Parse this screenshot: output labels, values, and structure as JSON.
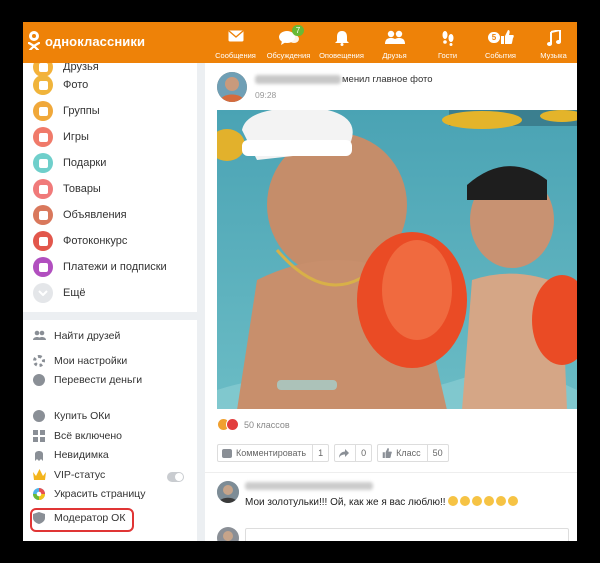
{
  "header": {
    "logo_text": "одноклассники",
    "nav": [
      {
        "label": "Сообщения",
        "icon": "envelope-icon",
        "badge": ""
      },
      {
        "label": "Обсуждения",
        "icon": "chat-bubbles-icon",
        "badge": "7"
      },
      {
        "label": "Оповещения",
        "icon": "bell-icon",
        "badge": ""
      },
      {
        "label": "Друзья",
        "icon": "people-icon",
        "badge": ""
      },
      {
        "label": "Гости",
        "icon": "footprints-icon",
        "badge": ""
      },
      {
        "label": "События",
        "icon": "thumbs-up-icon",
        "badge": "5"
      },
      {
        "label": "Музыка",
        "icon": "music-note-icon",
        "badge": ""
      }
    ]
  },
  "sidebar": {
    "menu": [
      {
        "label": "Друзья",
        "icon": "friends-icon",
        "color": "#f4b23a"
      },
      {
        "label": "Фото",
        "icon": "photo-icon",
        "color": "#f0b43b"
      },
      {
        "label": "Группы",
        "icon": "groups-icon",
        "color": "#f0a83a"
      },
      {
        "label": "Игры",
        "icon": "games-icon",
        "color": "#f07a6a"
      },
      {
        "label": "Подарки",
        "icon": "gift-icon",
        "color": "#6fcfcb"
      },
      {
        "label": "Товары",
        "icon": "shopping-bag-icon",
        "color": "#f07a7a"
      },
      {
        "label": "Объявления",
        "icon": "ads-icon",
        "color": "#d9785c"
      },
      {
        "label": "Фотоконкурс",
        "icon": "trophy-icon",
        "color": "#e2574c"
      },
      {
        "label": "Платежи и подписки",
        "icon": "wallet-icon",
        "color": "#b14fbf"
      },
      {
        "label": "Ещё",
        "icon": "chevron-down-icon",
        "color": "#d8dadd"
      }
    ],
    "links": [
      {
        "label": "Найти друзей",
        "icon": "find-friends-icon"
      },
      {
        "label": "Мои настройки",
        "icon": "gear-icon"
      },
      {
        "label": "Перевести деньги",
        "icon": "ruble-icon"
      },
      {
        "label": "Купить ОКи",
        "icon": "ok-coin-icon"
      },
      {
        "label": "Всё включено",
        "icon": "all-inclusive-icon"
      },
      {
        "label": "Невидимка",
        "icon": "invisible-icon"
      },
      {
        "label": "VIP-статус",
        "icon": "crown-icon"
      },
      {
        "label": "Украсить страницу",
        "icon": "palette-icon"
      },
      {
        "label": "Модератор ОК",
        "icon": "moderator-icon"
      }
    ]
  },
  "post": {
    "action_text": "менил главное фото",
    "time": "09:28",
    "reactions_count": "50 классов",
    "actions": [
      {
        "label": "Комментировать",
        "count": "1",
        "icon": "comment-icon"
      },
      {
        "label": "",
        "count": "0",
        "icon": "share-arrow-icon"
      },
      {
        "label": "Класс",
        "count": "50",
        "icon": "like-icon"
      }
    ],
    "comment_text": "Мои золотульки!!! Ой, как же я вас люблю!!"
  },
  "colors": {
    "brand": "#ee8208",
    "moderator_highlight": "#e03535"
  }
}
